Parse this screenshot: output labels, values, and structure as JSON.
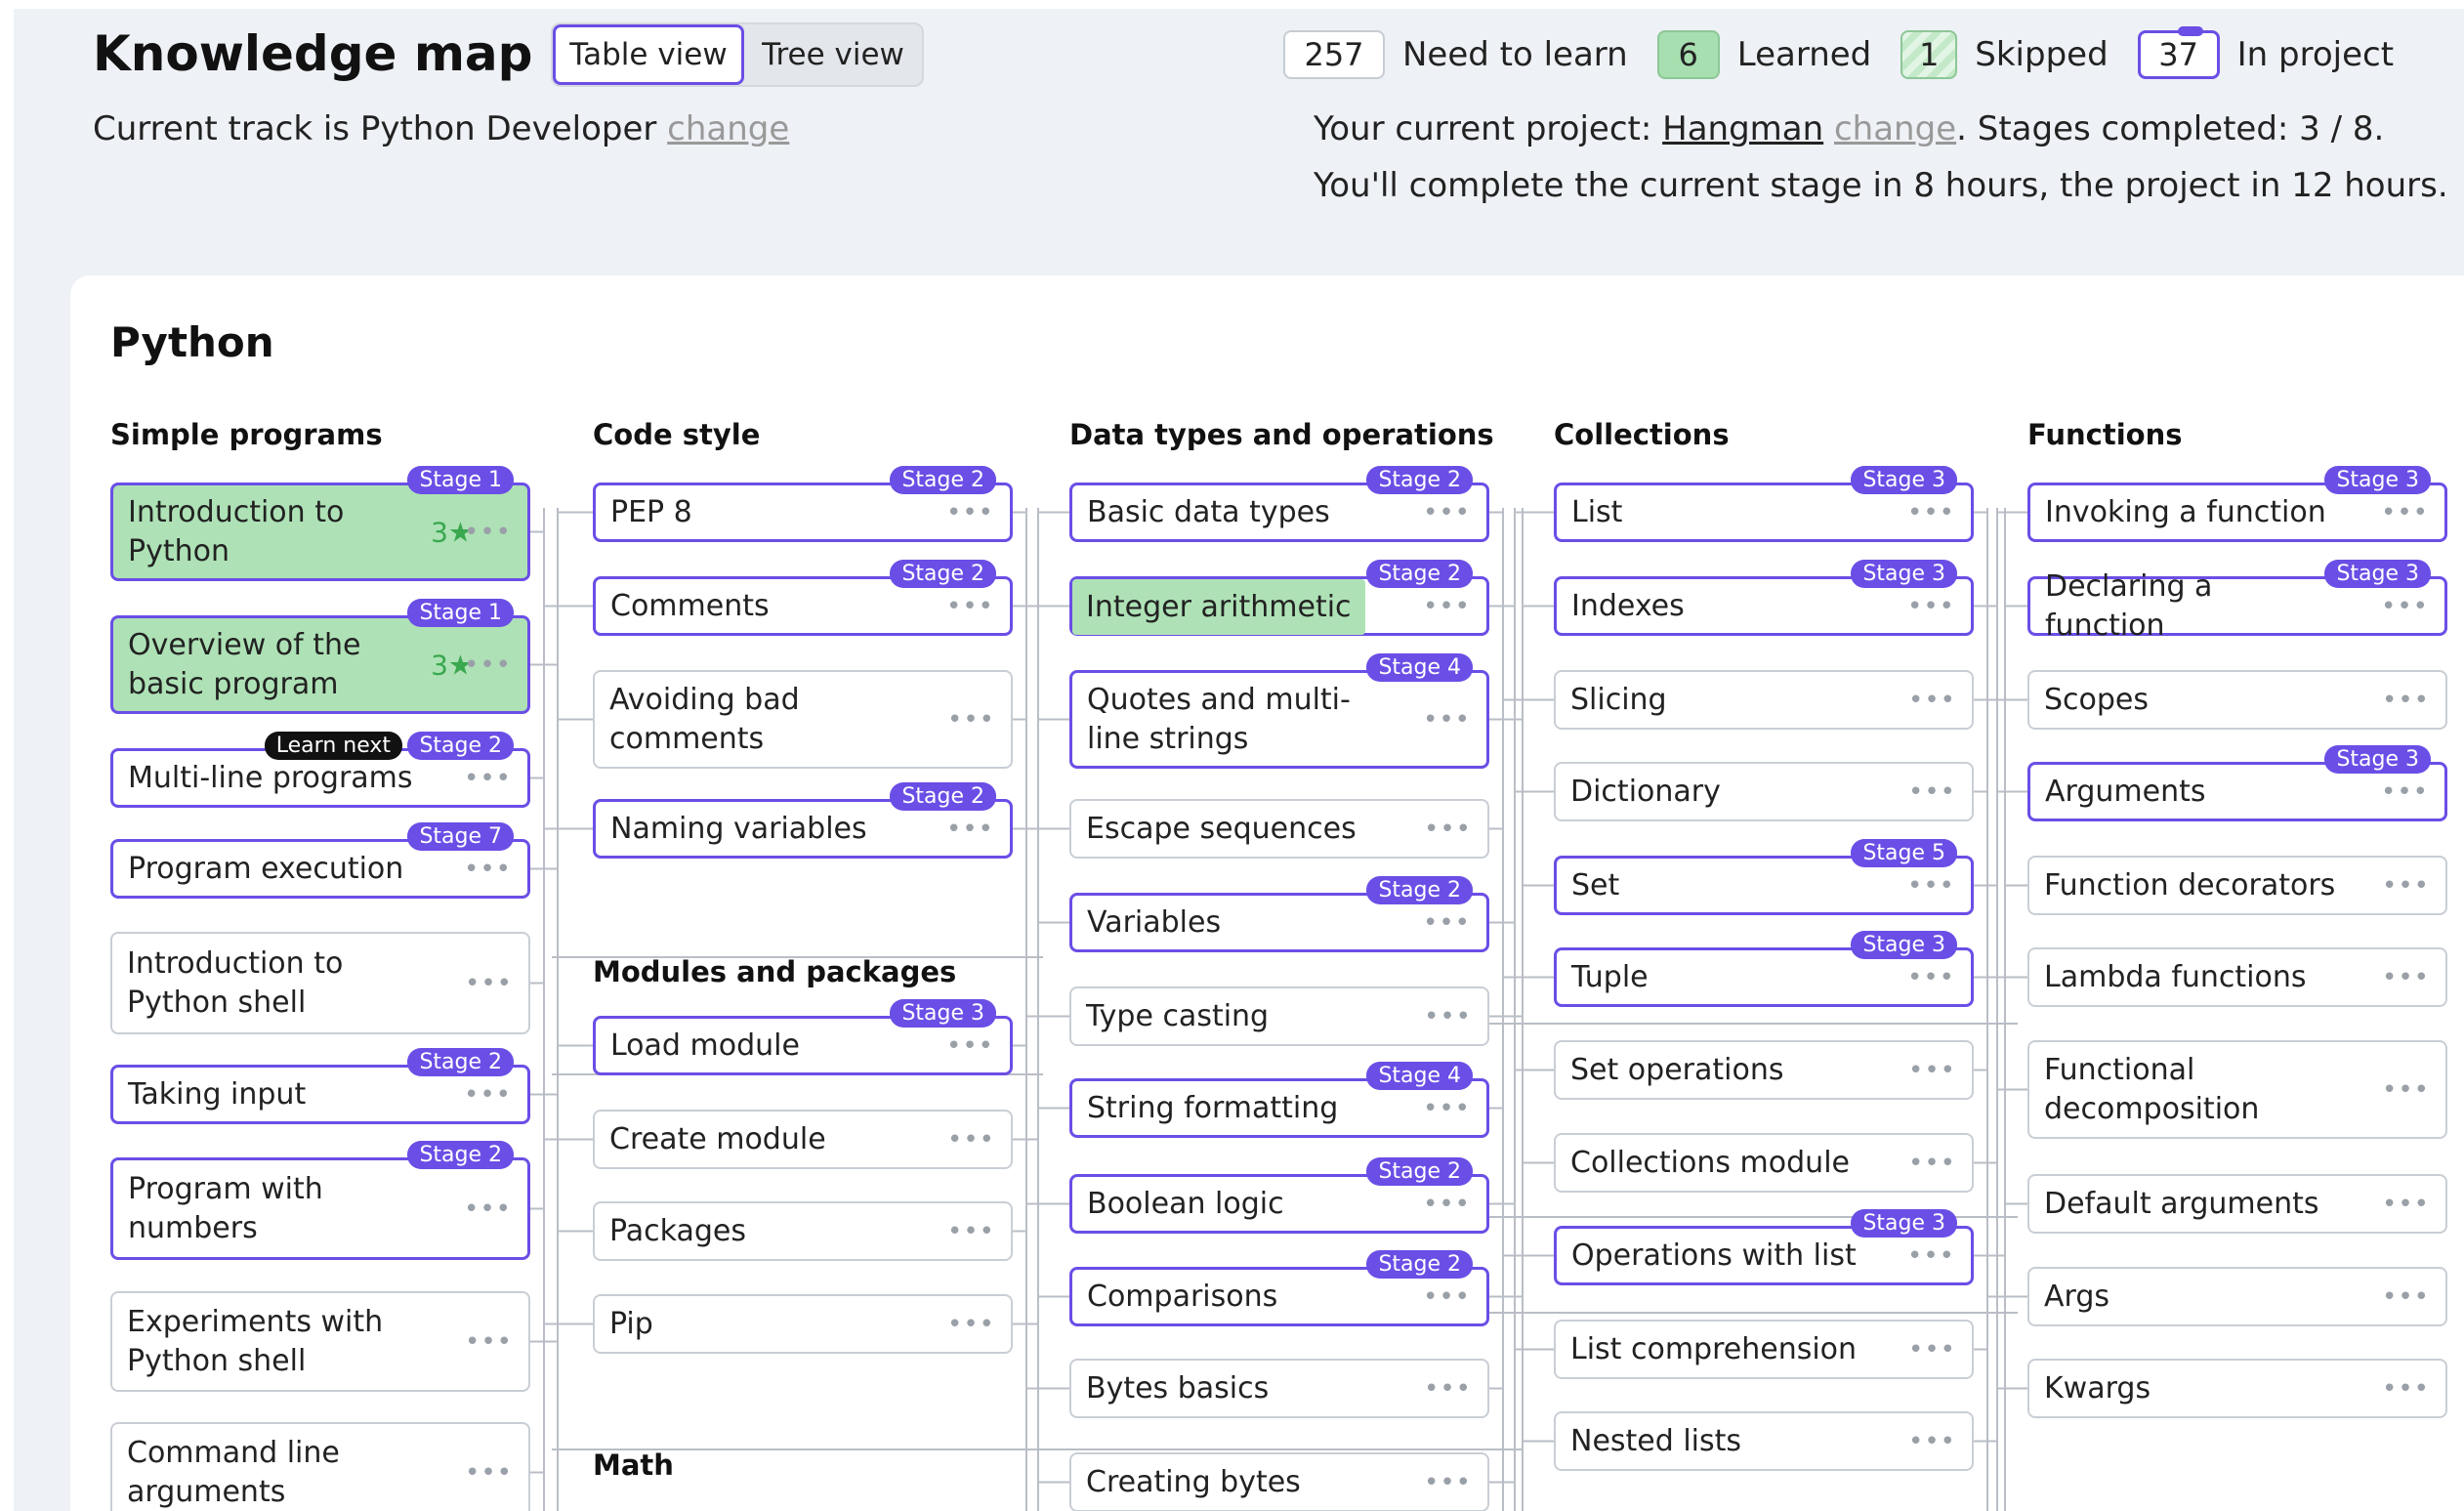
{
  "header": {
    "title": "Knowledge map",
    "view_toggle": {
      "table": "Table view",
      "tree": "Tree view"
    },
    "stats": {
      "need_to_learn": {
        "count": "257",
        "label": "Need to learn"
      },
      "learned": {
        "count": "6",
        "label": "Learned"
      },
      "skipped": {
        "count": "1",
        "label": "Skipped"
      },
      "in_project": {
        "count": "37",
        "label": "In project"
      }
    },
    "track": {
      "prefix": "Current track is",
      "name": "Python Developer",
      "change": "change"
    },
    "project": {
      "prefix": "Your current project:",
      "name": "Hangman",
      "change": "change",
      "stages_text": ". Stages completed:",
      "stages_value": "3 / 8",
      "stages_end": ".",
      "estimate": "You'll complete the current stage in 8 hours, the project in 12 hours."
    }
  },
  "colors": {
    "accent": "#6b4ee6",
    "learned": "#aee2b6",
    "star": "#3aa84f"
  },
  "map": {
    "title": "Python",
    "columns": [
      {
        "header": "Simple programs",
        "topics": [
          {
            "label": "Introduction to Python",
            "stage": "Stage 1",
            "stars": "3★",
            "learned": true
          },
          {
            "label": "Overview of the basic program",
            "stage": "Stage 1",
            "stars": "3★",
            "learned": true
          },
          {
            "label": "Multi-line programs",
            "stage": "Stage 2",
            "tag": "Learn next"
          },
          {
            "label": "Program execution",
            "stage": "Stage 7"
          },
          {
            "label": "Introduction to Python shell"
          },
          {
            "label": "Taking input",
            "stage": "Stage 2"
          },
          {
            "label": "Program with numbers",
            "stage": "Stage 2"
          },
          {
            "label": "Experiments with Python shell"
          },
          {
            "label": "Command line arguments"
          }
        ]
      },
      {
        "header": "Code style",
        "topics": [
          {
            "label": "PEP 8",
            "stage": "Stage 2"
          },
          {
            "label": "Comments",
            "stage": "Stage 2"
          },
          {
            "label": "Avoiding bad comments"
          },
          {
            "label": "Naming variables",
            "stage": "Stage 2"
          }
        ],
        "sections": [
          {
            "header": "Modules and packages",
            "topics": [
              {
                "label": "Load module",
                "stage": "Stage 3"
              },
              {
                "label": "Create module"
              },
              {
                "label": "Packages"
              },
              {
                "label": "Pip"
              }
            ]
          },
          {
            "header": "Math",
            "topics": []
          }
        ]
      },
      {
        "header": "Data types and operations",
        "topics": [
          {
            "label": "Basic data types",
            "stage": "Stage 2"
          },
          {
            "label": "Integer arithmetic",
            "stage": "Stage 2",
            "learned": true
          },
          {
            "label": "Quotes and multi-line strings",
            "stage": "Stage 4"
          },
          {
            "label": "Escape sequences"
          },
          {
            "label": "Variables",
            "stage": "Stage 2"
          },
          {
            "label": "Type casting"
          },
          {
            "label": "String formatting",
            "stage": "Stage 4"
          },
          {
            "label": "Boolean logic",
            "stage": "Stage 2"
          },
          {
            "label": "Comparisons",
            "stage": "Stage 2"
          },
          {
            "label": "Bytes basics"
          },
          {
            "label": "Creating bytes"
          }
        ]
      },
      {
        "header": "Collections",
        "topics": [
          {
            "label": "List",
            "stage": "Stage 3"
          },
          {
            "label": "Indexes",
            "stage": "Stage 3"
          },
          {
            "label": "Slicing"
          },
          {
            "label": "Dictionary"
          },
          {
            "label": "Set",
            "stage": "Stage 5"
          },
          {
            "label": "Tuple",
            "stage": "Stage 3"
          },
          {
            "label": "Set operations"
          },
          {
            "label": "Collections module"
          },
          {
            "label": "Operations with list",
            "stage": "Stage 3"
          },
          {
            "label": "List comprehension"
          },
          {
            "label": "Nested lists"
          }
        ]
      },
      {
        "header": "Functions",
        "topics": [
          {
            "label": "Invoking a function",
            "stage": "Stage 3"
          },
          {
            "label": "Declaring a function",
            "stage": "Stage 3"
          },
          {
            "label": "Scopes"
          },
          {
            "label": "Arguments",
            "stage": "Stage 3"
          },
          {
            "label": "Function decorators"
          },
          {
            "label": "Lambda functions"
          },
          {
            "label": "Functional decomposition"
          },
          {
            "label": "Default arguments"
          },
          {
            "label": "Args"
          },
          {
            "label": "Kwargs"
          }
        ]
      }
    ],
    "more_icon": "ellipsis-icon"
  }
}
